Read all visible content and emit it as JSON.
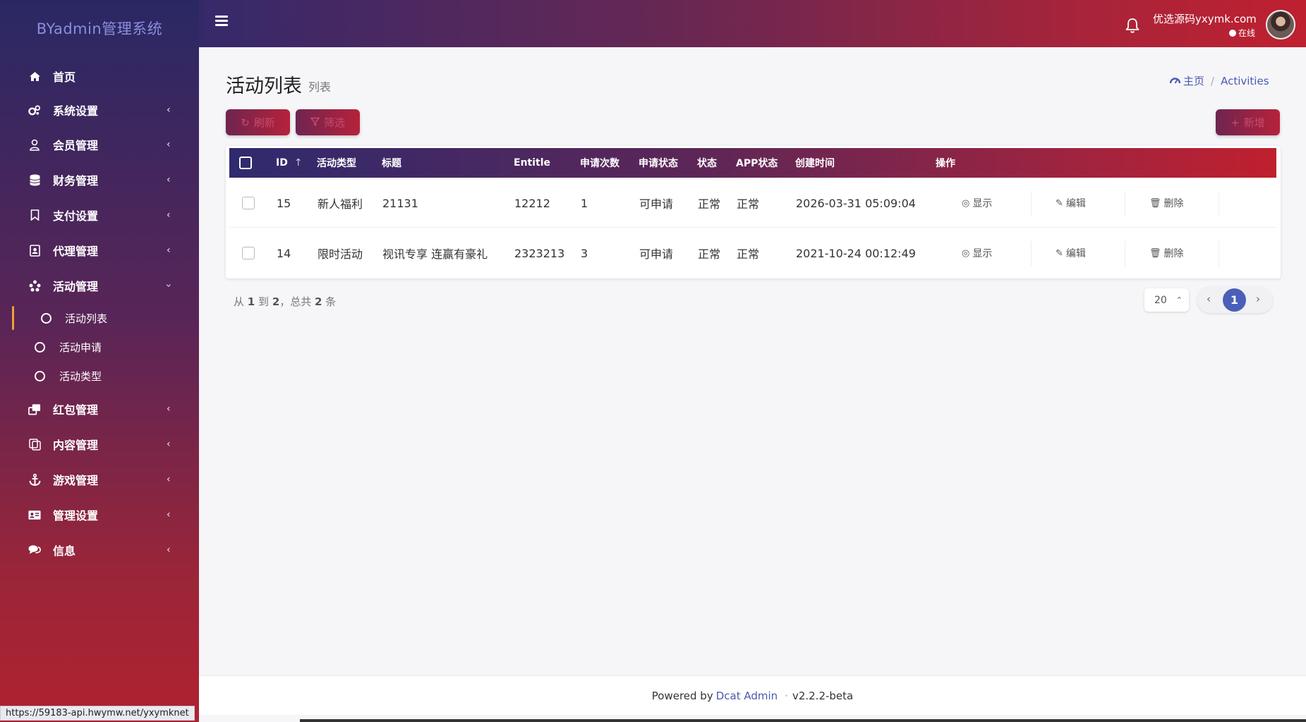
{
  "brand": "BYadmin管理系统",
  "sidebar": {
    "items": [
      {
        "label": "首页",
        "icon": "home-icon"
      },
      {
        "label": "系统设置",
        "icon": "gears-icon"
      },
      {
        "label": "会员管理",
        "icon": "user-icon"
      },
      {
        "label": "财务管理",
        "icon": "database-icon"
      },
      {
        "label": "支付设置",
        "icon": "bookmark-icon"
      },
      {
        "label": "代理管理",
        "icon": "id-badge-icon"
      },
      {
        "label": "活动管理",
        "icon": "asterisk-icon"
      },
      {
        "label": "红包管理",
        "icon": "clone-icon"
      },
      {
        "label": "内容管理",
        "icon": "copy-icon"
      },
      {
        "label": "游戏管理",
        "icon": "anchor-icon"
      },
      {
        "label": "管理设置",
        "icon": "id-card-icon"
      },
      {
        "label": "信息",
        "icon": "comments-icon"
      }
    ],
    "sub_items": [
      {
        "label": "活动列表"
      },
      {
        "label": "活动申请"
      },
      {
        "label": "活动类型"
      }
    ],
    "active_accent": "#f0a030"
  },
  "topbar": {
    "username": "优选源码yxymk.com",
    "status": "在线"
  },
  "page": {
    "title": "活动列表",
    "subtitle": "列表",
    "breadcrumb_home": "主页",
    "breadcrumb_current": "Activities"
  },
  "toolbar": {
    "refresh": "刷新",
    "filter": "筛选",
    "create": "新增"
  },
  "table": {
    "headers": [
      "ID",
      "活动类型",
      "标题",
      "Entitle",
      "申请次数",
      "申请状态",
      "状态",
      "APP状态",
      "创建时间",
      "操作"
    ],
    "rows": [
      [
        "15",
        "新人福利",
        "21131",
        "12212",
        "1",
        "可申请",
        "正常",
        "正常",
        "2026-03-31 05:09:04"
      ],
      [
        "14",
        "限时活动",
        "视讯专享 连赢有豪礼",
        "2323213",
        "3",
        "可申请",
        "正常",
        "正常",
        "2021-10-24 00:12:49"
      ]
    ],
    "actions": {
      "view": "显示",
      "edit": "编辑",
      "delete": "删除"
    }
  },
  "pagination": {
    "summary_from": "从",
    "start": "1",
    "summary_to": "到",
    "end": "2",
    "summary_total": "，总共",
    "total": "2",
    "summary_unit": "条",
    "per_page": "20",
    "current_page": "1"
  },
  "footer": {
    "powered": "Powered by",
    "link": "Dcat Admin",
    "sep": "·",
    "version": "v2.2.2-beta"
  },
  "status_url": "https://59183-api.hwymw.net/yxymknet",
  "colors": {
    "brand_text": "#8a8ee0",
    "accent_blue": "#4a5fb8",
    "gradient_dark": "#2a2864",
    "gradient_red": "#c0202e"
  }
}
